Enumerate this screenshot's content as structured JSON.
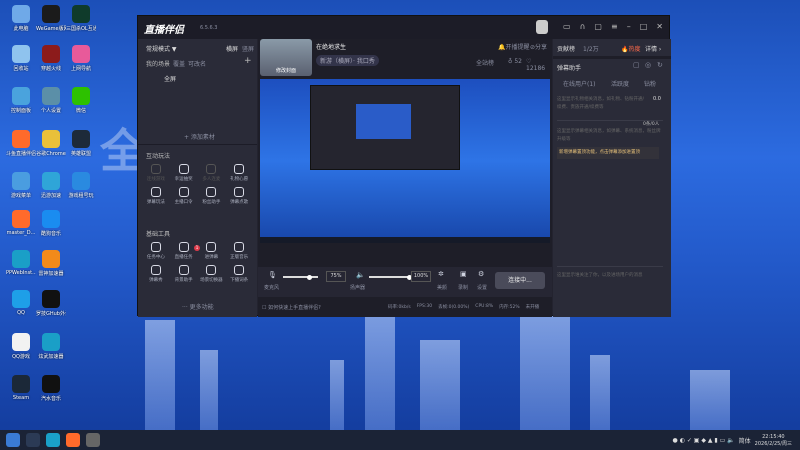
{
  "desktop": {
    "icons": [
      {
        "label": "此电脑",
        "color": "#6fa9e8"
      },
      {
        "label": "WeGame版网专版",
        "color": "#1b1b1b"
      },
      {
        "label": "三国杀OL互通版-steam",
        "color": "#0f3b2b"
      },
      {
        "label": "回收站",
        "color": "#8fc3ee"
      },
      {
        "label": "穿越火线",
        "color": "#8c1b1b"
      },
      {
        "label": "上网导航",
        "color": "#e85a9a"
      },
      {
        "label": "控制面板",
        "color": "#4aa3dd"
      },
      {
        "label": "个人设置",
        "color": "#5b8fa8"
      },
      {
        "label": "微信",
        "color": "#2dc100"
      },
      {
        "label": "斗鱼直播伴侣",
        "color": "#ff6a2b"
      },
      {
        "label": "谷歌Chrome",
        "color": "#e9c03a"
      },
      {
        "label": "英雄联盟",
        "color": "#1d2a3a"
      },
      {
        "label": "游戏菜单",
        "color": "#4a9de0"
      },
      {
        "label": "迅游加速",
        "color": "#2fa5d8"
      },
      {
        "label": "游戏租号玩",
        "color": "#2a8ae0"
      },
      {
        "label": "master_D...",
        "color": "#ff6a2b"
      },
      {
        "label": "酷狗音乐",
        "color": "#1a8cf0"
      },
      {
        "label": "PPWebInst...",
        "color": "#1a9fc7"
      },
      {
        "label": "雷神加速器",
        "color": "#f28a1a"
      },
      {
        "label": "QQ",
        "color": "#1e9fe8"
      },
      {
        "label": "罗技GHub外设",
        "color": "#111111"
      },
      {
        "label": "QQ游戏",
        "color": "#f2f2f2"
      },
      {
        "label": "炫武加速器",
        "color": "#1a9fc7"
      },
      {
        "label": "Steam",
        "color": "#1b2838"
      },
      {
        "label": "汽水音乐",
        "color": "#111111"
      }
    ],
    "banner_text": "全     上"
  },
  "app": {
    "logo": "直播伴侣",
    "version": "6.5.6.3",
    "window_controls": [
      "message-icon",
      "headset-icon",
      "clipboard-icon",
      "menu-icon",
      "minimize-icon",
      "maximize-icon",
      "close-icon"
    ],
    "left": {
      "mode": "常规模式 ▼",
      "orientation": [
        "横屏",
        "竖屏"
      ],
      "scenes_label": "我的场景",
      "scene_tabs": [
        "覆盖",
        "可改名"
      ],
      "scene_item": "全屏",
      "add_source": "+ 添加素材",
      "interactive_title": "互动玩法",
      "interactive": [
        "连线游戏",
        "幸运抽奖",
        "多人连麦",
        "礼物心愿",
        "弹幕玩法",
        "主播口令",
        "粉丝助手",
        "弹幕点歌"
      ],
      "basic_title": "基础工具",
      "basic": [
        "任务中心",
        "直播任务",
        "进弹幕",
        "正版音乐",
        "弹幕秀",
        "背景助手",
        "场景切换器",
        "下播词条"
      ],
      "basic_badge": "1",
      "more": "··· 更多功能"
    },
    "center": {
      "cover_label": "修改封面",
      "stream_title": "在绝地求生",
      "tags": [
        "新游（横屏）· 我口秀"
      ],
      "alert": "开播提醒",
      "share": "分享",
      "status": "全站榜",
      "likes": "52",
      "hearts": "12186",
      "mic_label": "麦克风",
      "mic_volume": "75%",
      "speaker_label": "扬声器",
      "speaker_volume": "100%",
      "mic_level": 0.75,
      "speaker_level": 1.0,
      "beauty": "美颜",
      "record": "录制",
      "settings": "设置",
      "connect": "连接中...",
      "help": "如何快速上手直播伴侣?",
      "stats": [
        "码率:0kb/s",
        "FPS:30",
        "丢帧:0(0.00%)",
        "CPU:8%",
        "内存:52%",
        "未开播"
      ]
    },
    "right": {
      "rank_label": "贡献榜",
      "rank_value": "1/2万",
      "hot": "热度",
      "detail": "详情 ›",
      "assistant": "弹幕助手",
      "tabs": [
        "在线用户(1)",
        "活跃度",
        "钻粉"
      ],
      "msg1": "这里显示礼物相关消息，如礼物、钻粉开通/续费、贵族开通/续费等",
      "msg1_value": "0.0",
      "msg2": "这里显示弹幕相关消息，如弹幕、系统消息，粉丝牌升级等",
      "msg2_badge": "0条/0人",
      "notice": "新增弹幕置顶功能，点击弹幕添加进置顶",
      "msg3": "这里显示谁关注了你，以及进场用户的消息"
    }
  },
  "taskbar": {
    "time": "22:15:40",
    "date": "2026/2/25/周三",
    "ime": "简体"
  }
}
